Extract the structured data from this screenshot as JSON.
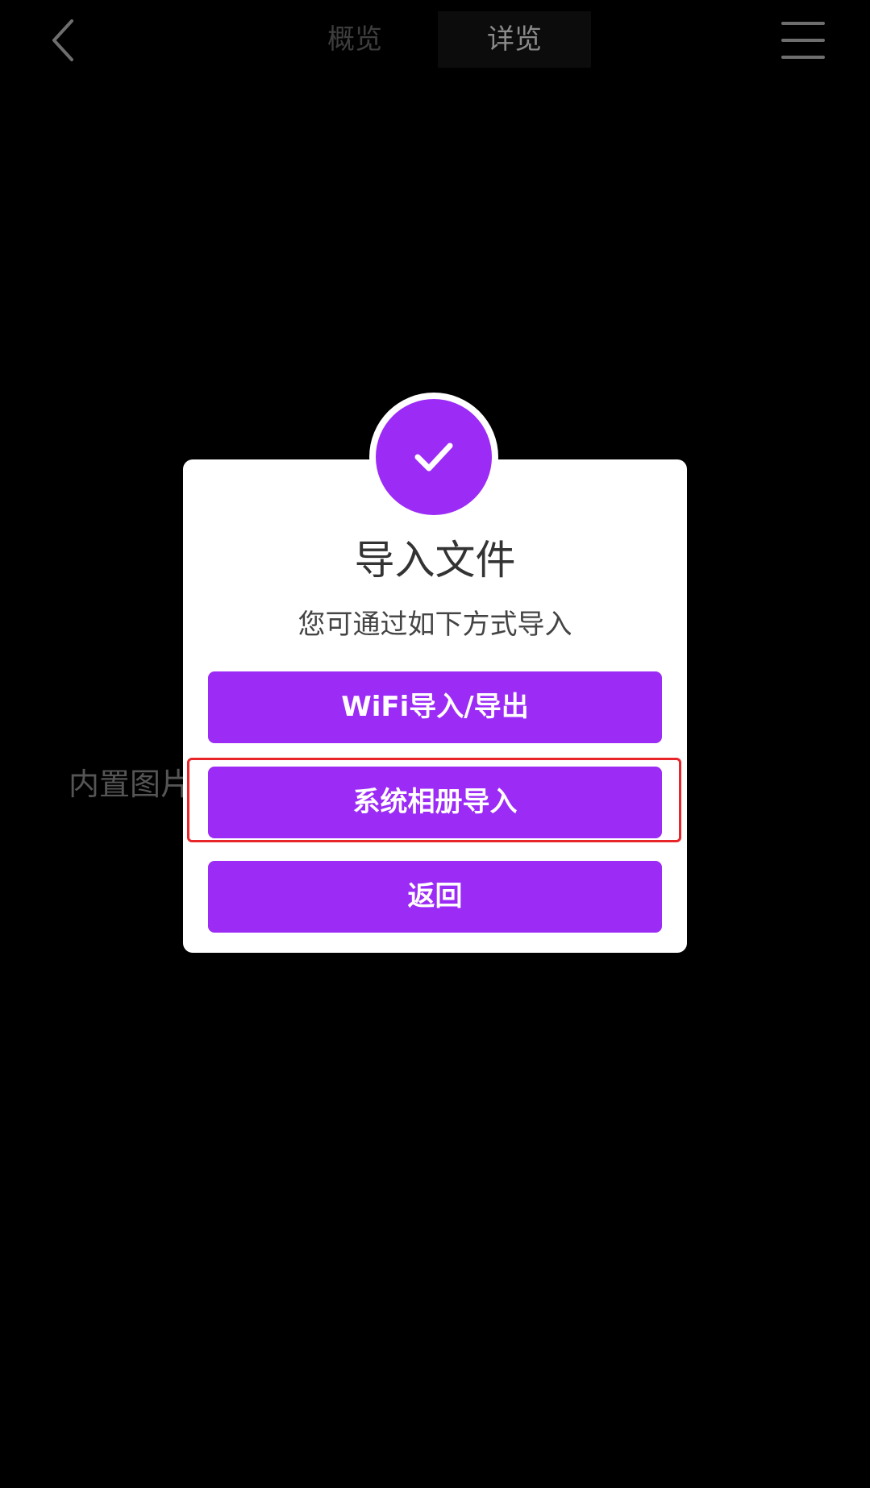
{
  "header": {
    "tabs": [
      {
        "label": "概览",
        "active": false
      },
      {
        "label": "详览",
        "active": true
      }
    ]
  },
  "background": {
    "text": "内置图片                                                      如全屏浏"
  },
  "modal": {
    "title": "导入文件",
    "subtitle": "您可通过如下方式导入",
    "buttons": {
      "wifi": "WiFi导入/导出",
      "album": "系统相册导入",
      "back": "返回"
    },
    "badge_icon": "checkmark-icon"
  },
  "colors": {
    "accent": "#9b2bf5",
    "highlight": "#e8262a",
    "background": "#000000"
  }
}
